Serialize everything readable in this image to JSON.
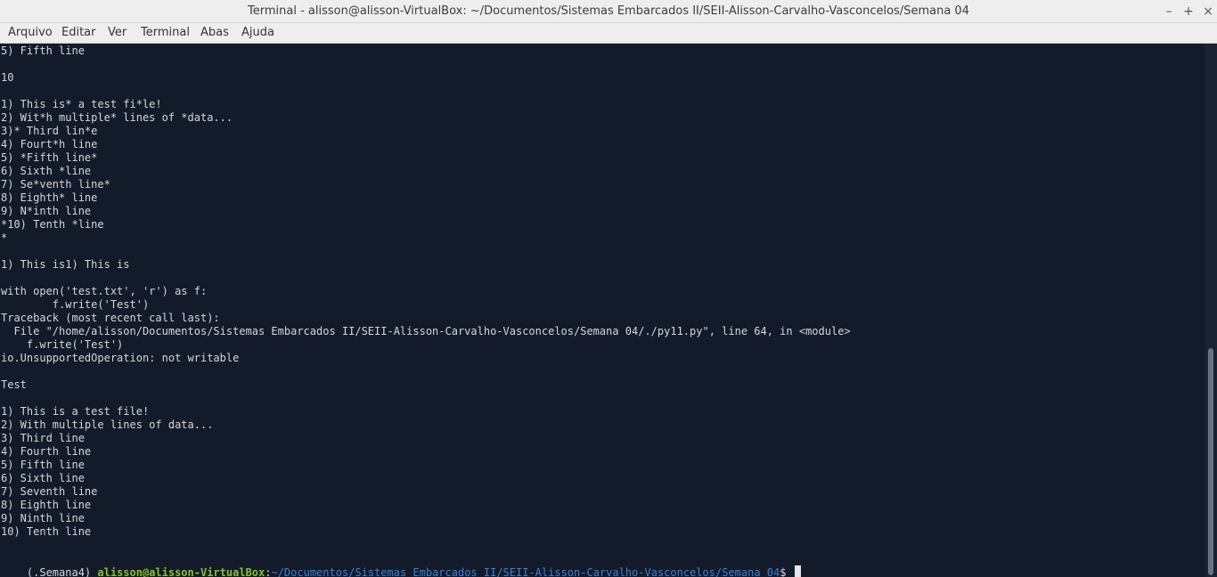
{
  "window": {
    "title": "Terminal - alisson@alisson-VirtualBox: ~/Documentos/Sistemas Embarcados II/SEII-Alisson-Carvalho-Vasconcelos/Semana 04",
    "controls": {
      "minimize": "–",
      "maximize": "+",
      "close": "×"
    }
  },
  "menu": [
    "Arquivo",
    "Editar",
    "Ver",
    "Terminal",
    "Abas",
    "Ajuda"
  ],
  "terminal": {
    "lines": [
      "5) Fifth line",
      "",
      "10",
      "",
      "1) This is* a test fi*le!",
      "2) Wit*h multiple* lines of *data...",
      "3)* Third lin*e",
      "4) Fourt*h line",
      "5) *Fifth line*",
      "6) Sixth *line",
      "7) Se*venth line*",
      "8) Eighth* line",
      "9) N*inth line",
      "*10) Tenth *line",
      "*",
      "",
      "1) This is1) This is",
      "",
      "with open('test.txt', 'r') as f:",
      "        f.write('Test')",
      "Traceback (most recent call last):",
      "  File \"/home/alisson/Documentos/Sistemas Embarcados II/SEII-Alisson-Carvalho-Vasconcelos/Semana 04/./py11.py\", line 64, in <module>",
      "    f.write('Test')",
      "io.UnsupportedOperation: not writable",
      "",
      "Test",
      "",
      "1) This is a test file!",
      "2) With multiple lines of data...",
      "3) Third line",
      "4) Fourth line",
      "5) Fifth line",
      "6) Sixth line",
      "7) Seventh line",
      "8) Eighth line",
      "9) Ninth line",
      "10) Tenth line",
      ""
    ],
    "prompt": {
      "env": "(.Semana4) ",
      "user_host": "alisson@alisson-VirtualBox",
      "separator": ":",
      "path": "~/Documentos/Sistemas Embarcados II/SEII-Alisson-Carvalho-Vasconcelos/Semana 04",
      "symbol": "$ "
    }
  },
  "colors": {
    "background": "#131b2b",
    "text": "#d6d6d6",
    "user_host": "#85c226",
    "path": "#3d7fd6"
  }
}
